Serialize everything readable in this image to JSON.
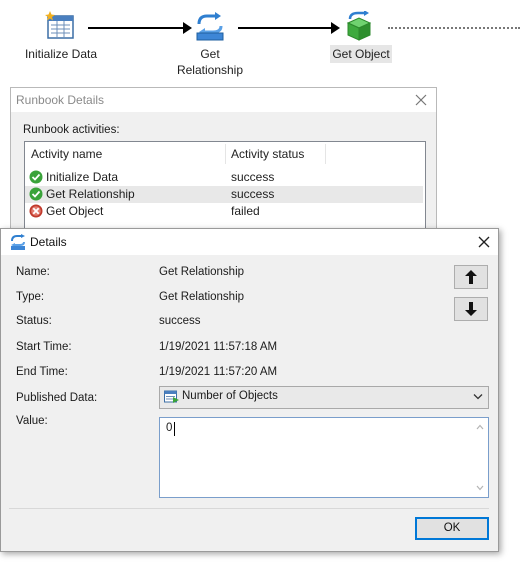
{
  "workflow": {
    "nodes": [
      {
        "label": "Initialize Data",
        "icon": "initialize-data-icon"
      },
      {
        "label": "Get\nRelationship",
        "icon": "get-relationship-icon"
      },
      {
        "label": "Get Object",
        "icon": "get-object-icon"
      }
    ]
  },
  "runbook_window": {
    "title": "Runbook Details",
    "section_label": "Runbook activities:",
    "columns": [
      "Activity name",
      "Activity status"
    ],
    "rows": [
      {
        "name": "Initialize Data",
        "status": "success",
        "status_icon": "success-check-icon"
      },
      {
        "name": "Get Relationship",
        "status": "success",
        "status_icon": "success-check-icon"
      },
      {
        "name": "Get Object",
        "status": "failed",
        "status_icon": "failed-x-icon"
      }
    ]
  },
  "details_dialog": {
    "title": "Details",
    "fields": [
      {
        "label": "Name:",
        "value": "Get Relationship"
      },
      {
        "label": "Type:",
        "value": "Get Relationship"
      },
      {
        "label": "Status:",
        "value": "success"
      },
      {
        "label": "Start Time:",
        "value": "1/19/2021 11:57:18 AM"
      },
      {
        "label": "End Time:",
        "value": "1/19/2021 11:57:20 AM"
      }
    ],
    "published_data_label": "Published Data:",
    "published_data_selected": "Number of Objects",
    "value_label": "Value:",
    "value_text": "0",
    "ok_label": "OK",
    "up_icon": "arrow-up-icon",
    "down_icon": "arrow-down-icon"
  },
  "colors": {
    "accent": "#0078d7",
    "success": "#3aa33a",
    "failed": "#c0392b",
    "selected_row": "#e8e8e8"
  }
}
